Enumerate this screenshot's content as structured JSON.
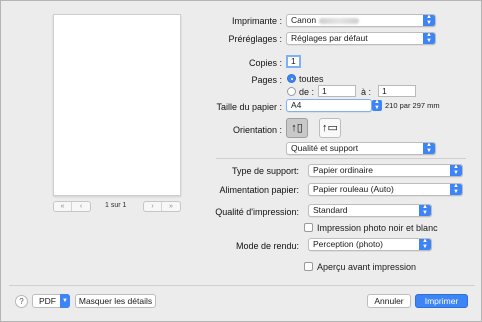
{
  "preview": {
    "page_count": "1 sur 1",
    "nav": [
      "«",
      "‹",
      "›",
      "»"
    ]
  },
  "printer": {
    "label": "Imprimante :",
    "value": "Canon"
  },
  "presets": {
    "label": "Préréglages :",
    "value": "Réglages par défaut"
  },
  "copies": {
    "label": "Copies :",
    "value": "1"
  },
  "pages": {
    "label": "Pages :",
    "all_label": "toutes",
    "from_label": "de :",
    "from_value": "1",
    "to_label": "à :",
    "to_value": "1",
    "selected": "all"
  },
  "paper_size": {
    "label": "Taille du papier :",
    "value": "A4",
    "dims": "210 par 297 mm"
  },
  "orientation": {
    "label": "Orientation :",
    "selected": "portrait"
  },
  "section": {
    "value": "Qualité et support"
  },
  "media_type": {
    "label": "Type de support:",
    "value": "Papier ordinaire"
  },
  "paper_source": {
    "label": "Alimentation papier:",
    "value": "Papier rouleau (Auto)"
  },
  "print_quality": {
    "label": "Qualité d'impression:",
    "value": "Standard"
  },
  "grayscale": {
    "label": "Impression photo noir et blanc",
    "checked": false
  },
  "render_mode": {
    "label": "Mode de rendu:",
    "value": "Perception (photo)"
  },
  "preview_check": {
    "label": "Aperçu avant impression",
    "checked": false
  },
  "footer": {
    "help": "?",
    "pdf": "PDF",
    "hide_details": "Masquer les détails",
    "cancel": "Annuler",
    "print": "Imprimer"
  },
  "colors": {
    "accent": "#3d84f6",
    "background": "#ececec"
  }
}
